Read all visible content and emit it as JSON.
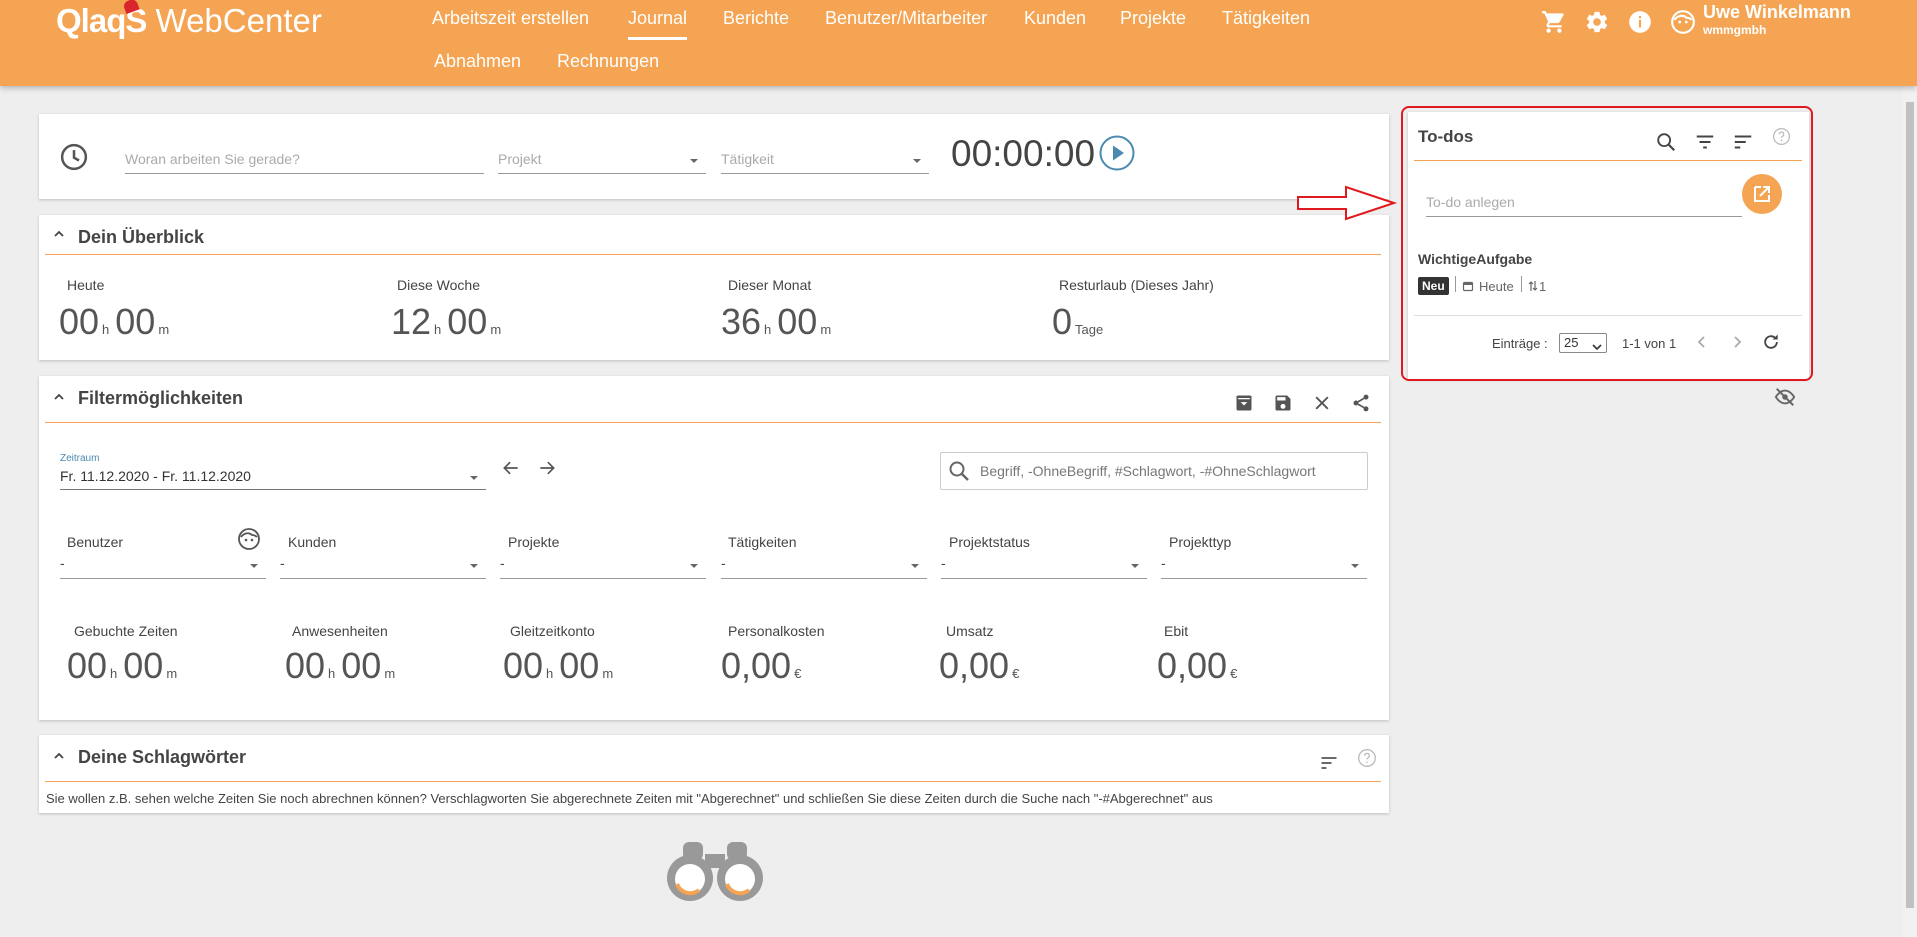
{
  "header": {
    "logo_bold": "QlaqS",
    "logo_rest": " WebCenter",
    "nav": [
      {
        "label": "Arbeitszeit erstellen"
      },
      {
        "label": "Journal"
      },
      {
        "label": "Berichte"
      },
      {
        "label": "Benutzer/Mitarbeiter"
      },
      {
        "label": "Kunden"
      },
      {
        "label": "Projekte"
      },
      {
        "label": "Tätigkeiten"
      },
      {
        "label": "Abnahmen"
      },
      {
        "label": "Rechnungen"
      }
    ],
    "active_nav": "Journal",
    "user_name": "Uwe Winkelmann",
    "user_org": "wmmgmbh"
  },
  "timer": {
    "task_placeholder": "Woran arbeiten Sie gerade?",
    "project_placeholder": "Projekt",
    "activity_placeholder": "Tätigkeit",
    "time": "00:00:00"
  },
  "overview": {
    "title": "Dein Überblick",
    "items": [
      {
        "label": "Heute",
        "h": "00",
        "m": "00"
      },
      {
        "label": "Diese Woche",
        "h": "12",
        "m": "00"
      },
      {
        "label": "Dieser Monat",
        "h": "36",
        "m": "00"
      }
    ],
    "vacation": {
      "label": "Resturlaub (Dieses Jahr)",
      "value": "0",
      "unit": "Tage"
    },
    "unit_h": "h",
    "unit_m": "m"
  },
  "filter": {
    "title": "Filtermöglichkeiten",
    "period_label": "Zeitraum",
    "period_value": "Fr. 11.12.2020 - Fr. 11.12.2020",
    "search_placeholder": "Begriff, -OhneBegriff, #Schlagwort, -#OhneSchlagwort",
    "selects": [
      {
        "label": "Benutzer",
        "value": "-"
      },
      {
        "label": "Kunden",
        "value": "-"
      },
      {
        "label": "Projekte",
        "value": "-"
      },
      {
        "label": "Tätigkeiten",
        "value": "-"
      },
      {
        "label": "Projektstatus",
        "value": "-"
      },
      {
        "label": "Projekttyp",
        "value": "-"
      }
    ],
    "stats_time": [
      {
        "label": "Gebuchte Zeiten",
        "h": "00",
        "m": "00"
      },
      {
        "label": "Anwesenheiten",
        "h": "00",
        "m": "00"
      },
      {
        "label": "Gleitzeitkonto",
        "h": "00",
        "m": "00"
      }
    ],
    "stats_money": [
      {
        "label": "Personalkosten",
        "value": "0,00",
        "unit": "€"
      },
      {
        "label": "Umsatz",
        "value": "0,00",
        "unit": "€"
      },
      {
        "label": "Ebit",
        "value": "0,00",
        "unit": "€"
      }
    ]
  },
  "tags": {
    "title": "Deine Schlagwörter",
    "hint": "Sie wollen z.B. sehen welche Zeiten Sie noch abrechnen können? Verschlagworten Sie abgerechnete Zeiten mit \"Abgerechnet\" und schließen Sie diese Zeiten durch die Suche nach \"-#Abgerechnet\" aus"
  },
  "todos": {
    "title": "To-dos",
    "new_placeholder": "To-do anlegen",
    "items": [
      {
        "title": "WichtigeAufgabe",
        "badge": "Neu",
        "due": "Heute",
        "count": "1"
      }
    ],
    "entries_label": "Einträge :",
    "page_size": "25",
    "range": "1-1 von 1"
  },
  "colors": {
    "brand": "#f4a452",
    "highlight": "#e0191f"
  }
}
